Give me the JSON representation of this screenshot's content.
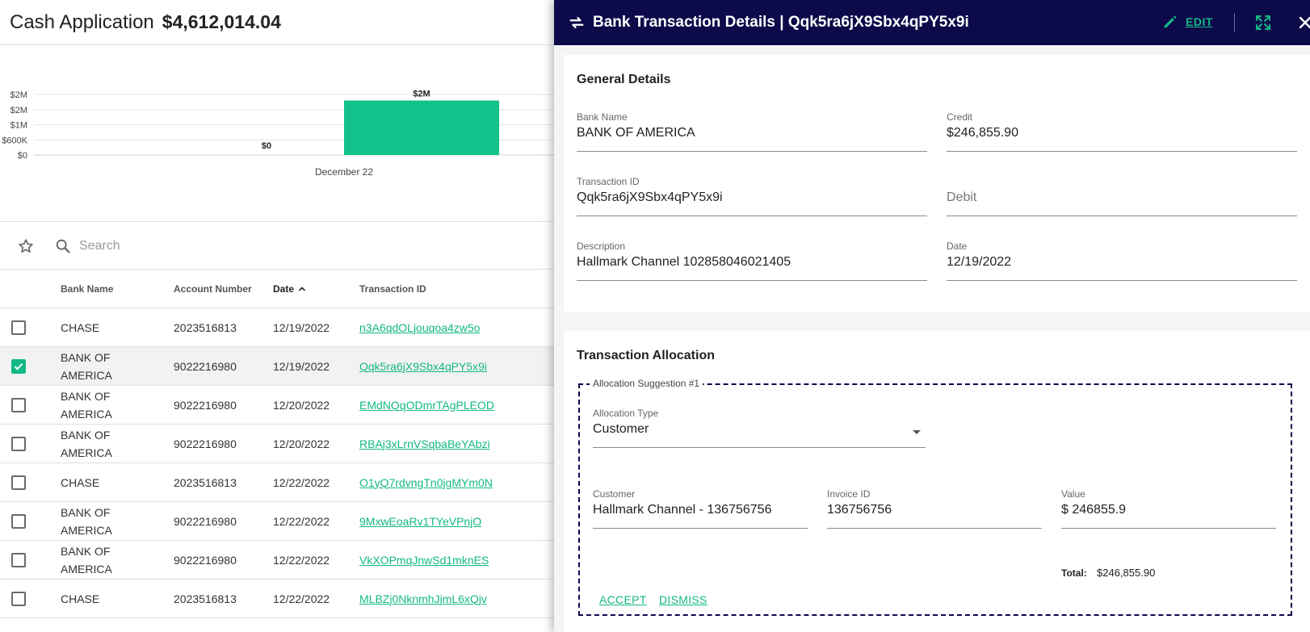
{
  "app": {
    "title": "Cash Application",
    "total": "$4,612,014.04"
  },
  "chart_data": {
    "type": "bar",
    "categories": [
      "",
      "December 22"
    ],
    "values": [
      0,
      1800000
    ],
    "data_labels": [
      "$0",
      "$2M"
    ],
    "y_tick_labels": [
      "$0",
      "$600K",
      "$1M",
      "$2M",
      "$2M"
    ],
    "x_tick_labels": [
      "December 22"
    ],
    "title": "",
    "xlabel": "",
    "ylabel": "",
    "ylim": [
      0,
      2000000
    ],
    "grid": true,
    "bar_color": "#12c28a"
  },
  "search": {
    "placeholder": "Search"
  },
  "table": {
    "headers": {
      "bank_name": "Bank Name",
      "account_number": "Account Number",
      "date": "Date",
      "transaction_id": "Transaction ID"
    },
    "rows": [
      {
        "checked": false,
        "bank_line1": "CHASE",
        "bank_line2": "",
        "account": "2023516813",
        "date": "12/19/2022",
        "tid": "n3A6qdOLjouqoa4zw5o"
      },
      {
        "checked": true,
        "bank_line1": "BANK OF",
        "bank_line2": "AMERICA",
        "account": "9022216980",
        "date": "12/19/2022",
        "tid": "Qqk5ra6jX9Sbx4qPY5x9i"
      },
      {
        "checked": false,
        "bank_line1": "BANK OF",
        "bank_line2": "AMERICA",
        "account": "9022216980",
        "date": "12/20/2022",
        "tid": "EMdNQqODmrTAgPLEOD"
      },
      {
        "checked": false,
        "bank_line1": "BANK OF",
        "bank_line2": "AMERICA",
        "account": "9022216980",
        "date": "12/20/2022",
        "tid": "RBAj3xLrnVSqbaBeYAbzi"
      },
      {
        "checked": false,
        "bank_line1": "CHASE",
        "bank_line2": "",
        "account": "2023516813",
        "date": "12/22/2022",
        "tid": "O1yQ7rdvngTn0jgMYm0N"
      },
      {
        "checked": false,
        "bank_line1": "BANK OF",
        "bank_line2": "AMERICA",
        "account": "9022216980",
        "date": "12/22/2022",
        "tid": "9MxwEoaRv1TYeVPnjO"
      },
      {
        "checked": false,
        "bank_line1": "BANK OF",
        "bank_line2": "AMERICA",
        "account": "9022216980",
        "date": "12/22/2022",
        "tid": "VkXOPmqJnwSd1mknES"
      },
      {
        "checked": false,
        "bank_line1": "CHASE",
        "bank_line2": "",
        "account": "2023516813",
        "date": "12/22/2022",
        "tid": "MLBZj0NknmhJjmL6xQjv"
      }
    ]
  },
  "panel": {
    "title": "Bank Transaction Details | Qqk5ra6jX9Sbx4qPY5x9i",
    "edit_label": "EDIT",
    "general": {
      "section_title": "General Details",
      "bank_name_label": "Bank Name",
      "bank_name_value": "BANK OF AMERICA",
      "credit_label": "Credit",
      "credit_value": "$246,855.90",
      "transaction_id_label": "Transaction ID",
      "transaction_id_value": "Qqk5ra6jX9Sbx4qPY5x9i",
      "debit_placeholder": "Debit",
      "description_label": "Description",
      "description_value": "Hallmark Channel 102858046021405",
      "date_label": "Date",
      "date_value": "12/19/2022"
    },
    "allocation": {
      "section_title": "Transaction Allocation",
      "suggestion_legend": "Allocation Suggestion #1",
      "type_label": "Allocation Type",
      "type_value": "Customer",
      "customer_label": "Customer",
      "customer_value": "Hallmark Channel - 136756756",
      "invoice_label": "Invoice ID",
      "invoice_value": "136756756",
      "value_label": "Value",
      "value_value": "$ 246855.9",
      "total_label": "Total:",
      "total_value": "$246,855.90",
      "accept_label": "ACCEPT",
      "dismiss_label": "DISMISS"
    }
  },
  "colors": {
    "accent": "#12b886",
    "header_bg": "#0d0a4a",
    "bar": "#12c28a"
  },
  "icons": {
    "favorite": "star-outline-icon",
    "search": "search-icon",
    "transfer": "swap-icon",
    "edit": "pencil-icon",
    "expand": "fullscreen-icon",
    "close": "close-icon",
    "checkbox_checked": "checkmark-icon",
    "sort": "chevron-up-icon",
    "dropdown": "caret-down-icon"
  }
}
